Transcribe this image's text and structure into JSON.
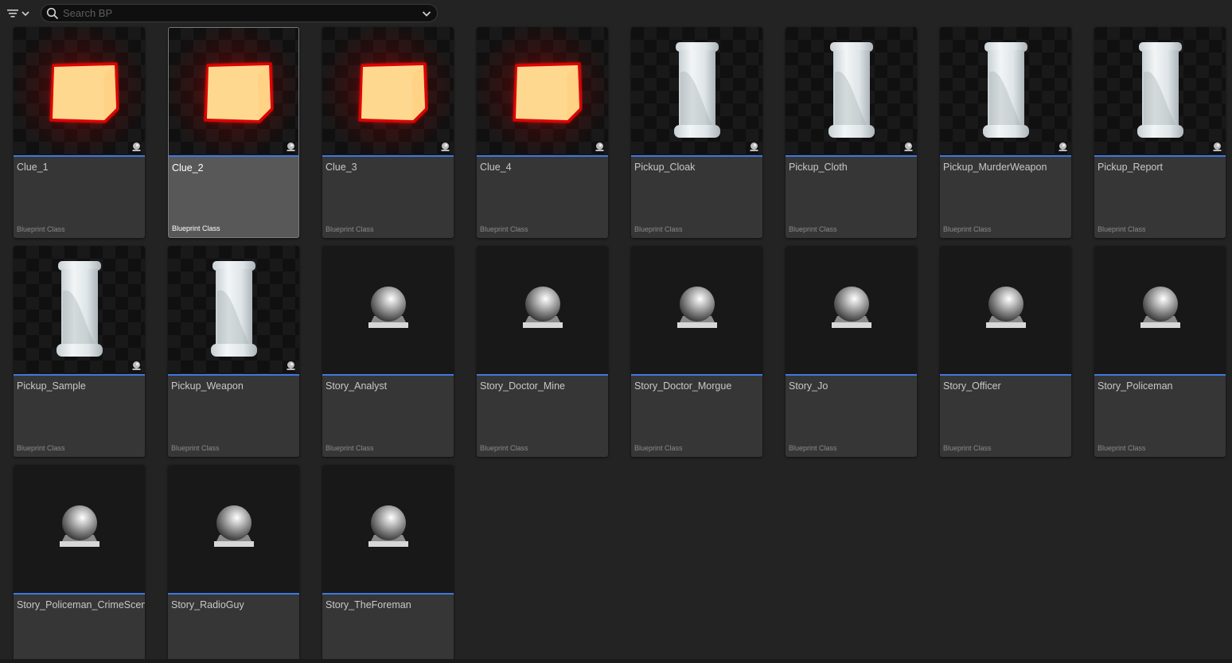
{
  "search": {
    "placeholder": "Search BP",
    "value": ""
  },
  "accent_color": "#3f78e0",
  "assets": [
    {
      "name": "Clue_1",
      "type": "Blueprint Class",
      "thumb": "cube",
      "selected": false
    },
    {
      "name": "Clue_2",
      "type": "Blueprint Class",
      "thumb": "cube",
      "selected": true
    },
    {
      "name": "Clue_3",
      "type": "Blueprint Class",
      "thumb": "cube",
      "selected": false
    },
    {
      "name": "Clue_4",
      "type": "Blueprint Class",
      "thumb": "cube",
      "selected": false
    },
    {
      "name": "Pickup_Cloak",
      "type": "Blueprint Class",
      "thumb": "cylinder",
      "selected": false
    },
    {
      "name": "Pickup_Cloth",
      "type": "Blueprint Class",
      "thumb": "cylinder",
      "selected": false
    },
    {
      "name": "Pickup_MurderWeapon",
      "type": "Blueprint Class",
      "thumb": "cylinder",
      "selected": false
    },
    {
      "name": "Pickup_Report",
      "type": "Blueprint Class",
      "thumb": "cylinder",
      "selected": false
    },
    {
      "name": "Pickup_Sample",
      "type": "Blueprint Class",
      "thumb": "cylinder",
      "selected": false
    },
    {
      "name": "Pickup_Weapon",
      "type": "Blueprint Class",
      "thumb": "cylinder",
      "selected": false
    },
    {
      "name": "Story_Analyst",
      "type": "Blueprint Class",
      "thumb": "sphere",
      "selected": false
    },
    {
      "name": "Story_Doctor_Mine",
      "type": "Blueprint Class",
      "thumb": "sphere",
      "selected": false
    },
    {
      "name": "Story_Doctor_Morgue",
      "type": "Blueprint Class",
      "thumb": "sphere",
      "selected": false
    },
    {
      "name": "Story_Jo",
      "type": "Blueprint Class",
      "thumb": "sphere",
      "selected": false
    },
    {
      "name": "Story_Officer",
      "type": "Blueprint Class",
      "thumb": "sphere",
      "selected": false
    },
    {
      "name": "Story_Policeman",
      "type": "Blueprint Class",
      "thumb": "sphere",
      "selected": false
    },
    {
      "name": "Story_Policeman_CrimeScene",
      "type": "",
      "thumb": "sphere",
      "selected": false
    },
    {
      "name": "Story_RadioGuy",
      "type": "",
      "thumb": "sphere",
      "selected": false
    },
    {
      "name": "Story_TheForeman",
      "type": "",
      "thumb": "sphere",
      "selected": false
    }
  ]
}
